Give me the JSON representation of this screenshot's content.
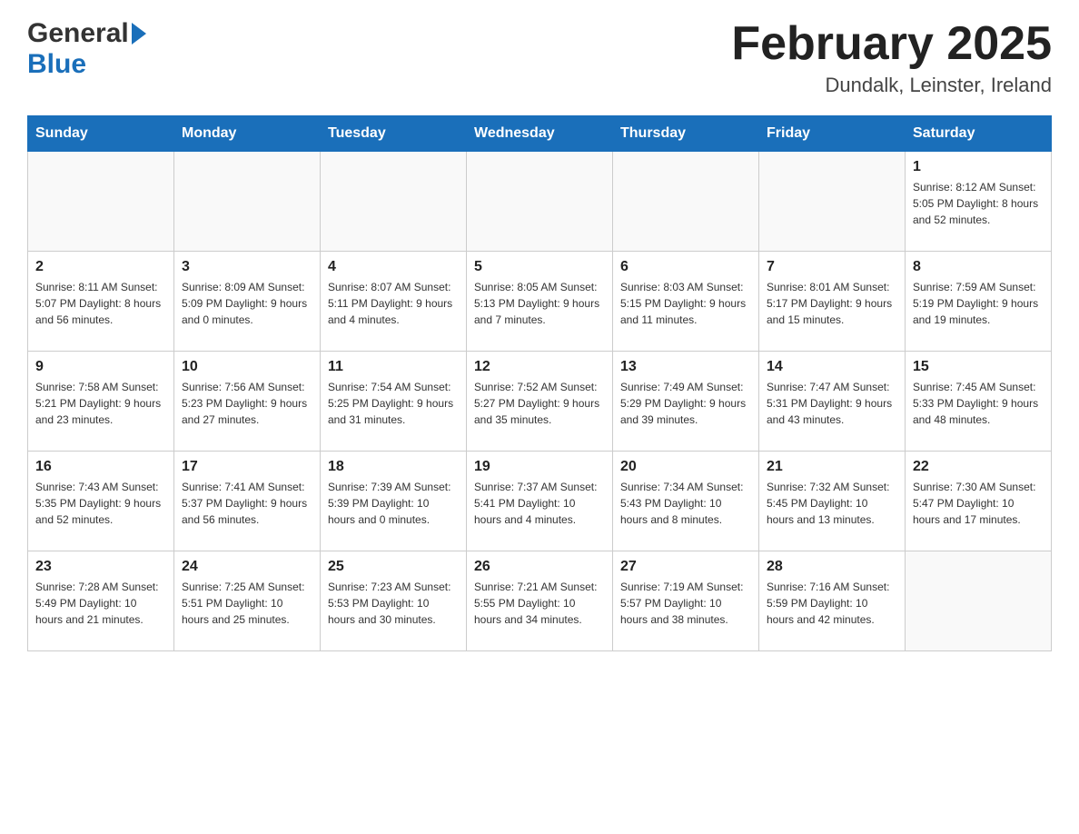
{
  "header": {
    "logo_general": "General",
    "logo_blue": "Blue",
    "month_title": "February 2025",
    "location": "Dundalk, Leinster, Ireland"
  },
  "weekdays": [
    "Sunday",
    "Monday",
    "Tuesday",
    "Wednesday",
    "Thursday",
    "Friday",
    "Saturday"
  ],
  "weeks": [
    [
      {
        "day": "",
        "info": ""
      },
      {
        "day": "",
        "info": ""
      },
      {
        "day": "",
        "info": ""
      },
      {
        "day": "",
        "info": ""
      },
      {
        "day": "",
        "info": ""
      },
      {
        "day": "",
        "info": ""
      },
      {
        "day": "1",
        "info": "Sunrise: 8:12 AM\nSunset: 5:05 PM\nDaylight: 8 hours and 52 minutes."
      }
    ],
    [
      {
        "day": "2",
        "info": "Sunrise: 8:11 AM\nSunset: 5:07 PM\nDaylight: 8 hours and 56 minutes."
      },
      {
        "day": "3",
        "info": "Sunrise: 8:09 AM\nSunset: 5:09 PM\nDaylight: 9 hours and 0 minutes."
      },
      {
        "day": "4",
        "info": "Sunrise: 8:07 AM\nSunset: 5:11 PM\nDaylight: 9 hours and 4 minutes."
      },
      {
        "day": "5",
        "info": "Sunrise: 8:05 AM\nSunset: 5:13 PM\nDaylight: 9 hours and 7 minutes."
      },
      {
        "day": "6",
        "info": "Sunrise: 8:03 AM\nSunset: 5:15 PM\nDaylight: 9 hours and 11 minutes."
      },
      {
        "day": "7",
        "info": "Sunrise: 8:01 AM\nSunset: 5:17 PM\nDaylight: 9 hours and 15 minutes."
      },
      {
        "day": "8",
        "info": "Sunrise: 7:59 AM\nSunset: 5:19 PM\nDaylight: 9 hours and 19 minutes."
      }
    ],
    [
      {
        "day": "9",
        "info": "Sunrise: 7:58 AM\nSunset: 5:21 PM\nDaylight: 9 hours and 23 minutes."
      },
      {
        "day": "10",
        "info": "Sunrise: 7:56 AM\nSunset: 5:23 PM\nDaylight: 9 hours and 27 minutes."
      },
      {
        "day": "11",
        "info": "Sunrise: 7:54 AM\nSunset: 5:25 PM\nDaylight: 9 hours and 31 minutes."
      },
      {
        "day": "12",
        "info": "Sunrise: 7:52 AM\nSunset: 5:27 PM\nDaylight: 9 hours and 35 minutes."
      },
      {
        "day": "13",
        "info": "Sunrise: 7:49 AM\nSunset: 5:29 PM\nDaylight: 9 hours and 39 minutes."
      },
      {
        "day": "14",
        "info": "Sunrise: 7:47 AM\nSunset: 5:31 PM\nDaylight: 9 hours and 43 minutes."
      },
      {
        "day": "15",
        "info": "Sunrise: 7:45 AM\nSunset: 5:33 PM\nDaylight: 9 hours and 48 minutes."
      }
    ],
    [
      {
        "day": "16",
        "info": "Sunrise: 7:43 AM\nSunset: 5:35 PM\nDaylight: 9 hours and 52 minutes."
      },
      {
        "day": "17",
        "info": "Sunrise: 7:41 AM\nSunset: 5:37 PM\nDaylight: 9 hours and 56 minutes."
      },
      {
        "day": "18",
        "info": "Sunrise: 7:39 AM\nSunset: 5:39 PM\nDaylight: 10 hours and 0 minutes."
      },
      {
        "day": "19",
        "info": "Sunrise: 7:37 AM\nSunset: 5:41 PM\nDaylight: 10 hours and 4 minutes."
      },
      {
        "day": "20",
        "info": "Sunrise: 7:34 AM\nSunset: 5:43 PM\nDaylight: 10 hours and 8 minutes."
      },
      {
        "day": "21",
        "info": "Sunrise: 7:32 AM\nSunset: 5:45 PM\nDaylight: 10 hours and 13 minutes."
      },
      {
        "day": "22",
        "info": "Sunrise: 7:30 AM\nSunset: 5:47 PM\nDaylight: 10 hours and 17 minutes."
      }
    ],
    [
      {
        "day": "23",
        "info": "Sunrise: 7:28 AM\nSunset: 5:49 PM\nDaylight: 10 hours and 21 minutes."
      },
      {
        "day": "24",
        "info": "Sunrise: 7:25 AM\nSunset: 5:51 PM\nDaylight: 10 hours and 25 minutes."
      },
      {
        "day": "25",
        "info": "Sunrise: 7:23 AM\nSunset: 5:53 PM\nDaylight: 10 hours and 30 minutes."
      },
      {
        "day": "26",
        "info": "Sunrise: 7:21 AM\nSunset: 5:55 PM\nDaylight: 10 hours and 34 minutes."
      },
      {
        "day": "27",
        "info": "Sunrise: 7:19 AM\nSunset: 5:57 PM\nDaylight: 10 hours and 38 minutes."
      },
      {
        "day": "28",
        "info": "Sunrise: 7:16 AM\nSunset: 5:59 PM\nDaylight: 10 hours and 42 minutes."
      },
      {
        "day": "",
        "info": ""
      }
    ]
  ]
}
